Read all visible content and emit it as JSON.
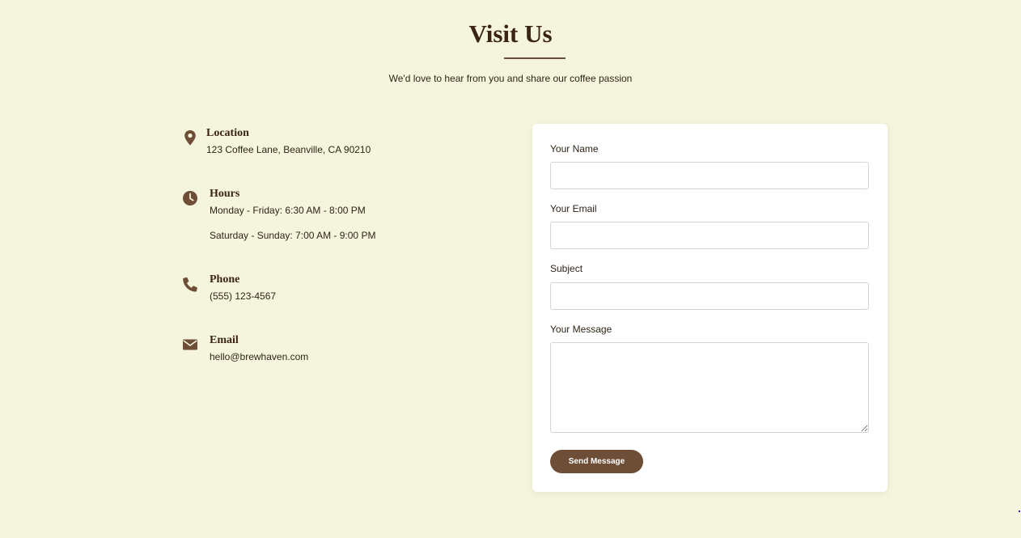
{
  "header": {
    "title": "Visit Us",
    "subtitle": "We'd love to hear from you and share our coffee passion"
  },
  "contact_info": {
    "location": {
      "icon": "map-pin-icon",
      "heading": "Location",
      "lines": [
        "123 Coffee Lane, Beanville, CA 90210"
      ]
    },
    "hours": {
      "icon": "clock-icon",
      "heading": "Hours",
      "lines": [
        "Monday - Friday: 6:30 AM - 8:00 PM",
        "Saturday - Sunday: 7:00 AM - 9:00 PM"
      ]
    },
    "phone": {
      "icon": "phone-icon",
      "heading": "Phone",
      "lines": [
        "(555) 123-4567"
      ]
    },
    "email": {
      "icon": "envelope-icon",
      "heading": "Email",
      "lines": [
        "hello@brewhaven.com"
      ]
    }
  },
  "form": {
    "name_label": "Your Name",
    "name_value": "",
    "email_label": "Your Email",
    "email_value": "",
    "subject_label": "Subject",
    "subject_value": "",
    "message_label": "Your Message",
    "message_value": "",
    "submit_label": "Send Message"
  },
  "colors": {
    "background": "#f5f4dc",
    "accent": "#6f4e37",
    "heading_text": "#3b2416",
    "card": "#ffffff"
  }
}
